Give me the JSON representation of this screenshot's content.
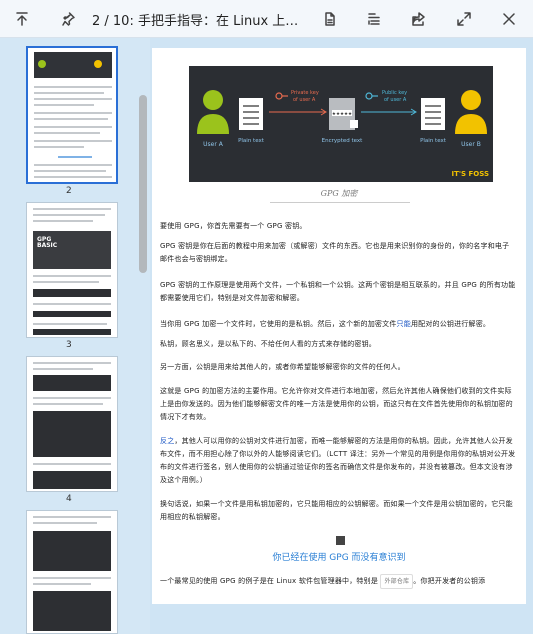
{
  "toolbar": {
    "page_indicator": "2 / 10",
    "title": "手把手指导：在 Linux 上使用…",
    "icons": [
      "scroll-top-icon",
      "pin-icon",
      "document-icon",
      "outline-icon",
      "share-icon",
      "expand-icon",
      "close-icon"
    ]
  },
  "sidebar": {
    "selected_page": 1
  },
  "figure": {
    "user_a": "User A",
    "user_b": "User B",
    "plain_text_1": "Plain text",
    "plain_text_2": "Plain text",
    "encrypted_text": "Encrypted text",
    "private_key": "Private key\nof user A",
    "public_key": "Public key\nof user A",
    "brand": "IT'S FOSS"
  },
  "document": {
    "caption": "GPG 加密",
    "p1": "要使用 GPG，你首先需要有一个 GPG 密钥。",
    "p2": "GPG 密钥是你在后面的教程中用来加密（或解密）文件的东西。它也是用来识别你的身份的，你的名字和电子邮件也会与密钥绑定。",
    "p3": "GPG 密钥的工作原理是使用两个文件，一个私钥和一个公钥。这两个密钥是相互联系的，并且 GPG 的所有功能都需要使用它们，特别是对文件加密和解密。",
    "p4a": "当你用 GPG 加密一个文件时，它使用的是私钥。然后，这个新的加密文件",
    "p4b": "只能",
    "p4c": "用配对的公钥进行解密。",
    "p5": "私钥，顾名思义，是以私下的、不给任何人看的方式来存储的密钥。",
    "p6": "另一方面，公钥是用来给其他人的，或者你希望能够解密你的文件的任何人。",
    "p7": "这就是 GPG 的加密方法的主要作用。它允许你对文件进行本地加密，然后允许其他人确保他们收到的文件实际上是由你发送的。因为他们能够解密文件的唯一方法是使用你的公钥，而这只有在文件首先使用你的私钥加密的情况下才有效。",
    "p8a": "反之",
    "p8b": "，其他人可以用你的公钥对文件进行加密，而唯一能够解密的方法是用你的私钥。因此，允许其他人公开发布文件，而不用担心除了你以外的人能够阅读它们。（LCTT 译注：另外一个常见的用例是你用你的私钥对公开发布的文件进行签名，别人使用你的公钥通过验证你的签名而确信文件是你发布的，并没有被篡改。但本文没有涉及这个用例。）",
    "p9": "换句话说，如果一个文件是用私钥加密的，它只能用相应的公钥解密。而如果一个文件是用公钥加密的，它只能用相应的私钥解密。",
    "heading": "你已经在使用 GPG 而没有意识到",
    "p10a": "一个最常见的使用 GPG 的例子是在 Linux 软件包管理器中，特别是",
    "p10_badge": "外部仓库",
    "p10b": "。你把开发者的公钥添"
  },
  "colors": {
    "accent": "#2a6fd6",
    "heading": "#2a7fd4",
    "user": "#9bc31c",
    "brand": "#f2c200"
  }
}
